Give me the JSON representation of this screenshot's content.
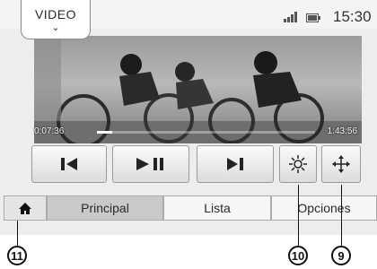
{
  "status": {
    "app_title": "VIDEO",
    "chevron": "⌄",
    "signal_icon": "signal-icon",
    "battery_icon": "battery-icon",
    "temperature": "--°",
    "time": "15:30"
  },
  "player": {
    "elapsed": "0:07:36",
    "total": "1:43:56",
    "progress_fraction": 0.07
  },
  "controls": [
    {
      "name": "previous",
      "icon": "skip-previous-icon"
    },
    {
      "name": "play-pause",
      "icon": "play-pause-icon"
    },
    {
      "name": "next",
      "icon": "skip-next-icon"
    },
    {
      "name": "brightness",
      "icon": "brightness-icon"
    },
    {
      "name": "display-format",
      "icon": "move-arrows-icon"
    }
  ],
  "tabs": {
    "home_icon": "home-icon",
    "principal": "Principal",
    "lista": "Lista",
    "opciones": "Opciones",
    "active": "principal"
  },
  "callouts": {
    "home": "11",
    "brightness": "10",
    "format": "9"
  }
}
